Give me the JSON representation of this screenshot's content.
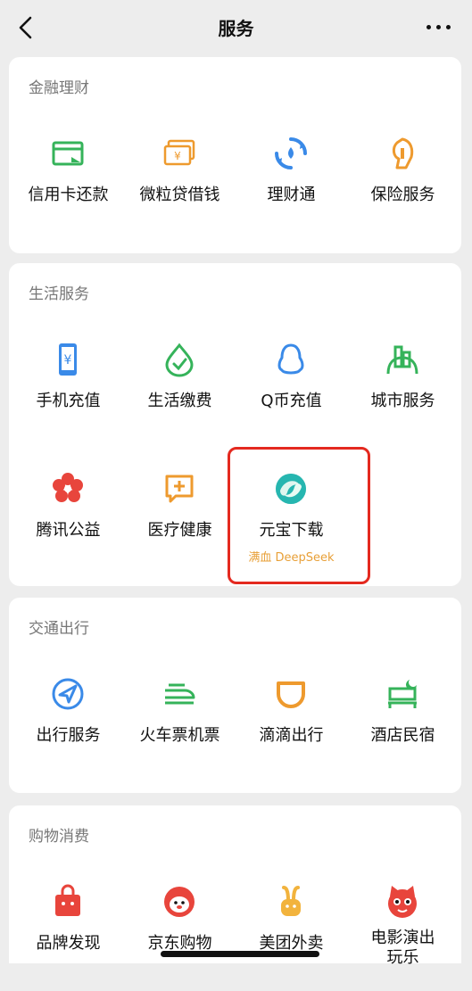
{
  "header": {
    "title": "服务"
  },
  "sections": [
    {
      "title": "金融理财",
      "items": [
        {
          "label": "信用卡还款",
          "icon": "card-icon"
        },
        {
          "label": "微粒贷借钱",
          "icon": "money-icon"
        },
        {
          "label": "理财通",
          "icon": "refresh-droplet-icon"
        },
        {
          "label": "保险服务",
          "icon": "umbrella-icon"
        }
      ]
    },
    {
      "title": "生活服务",
      "items": [
        {
          "label": "手机充值",
          "icon": "phone-yuan-icon"
        },
        {
          "label": "生活缴费",
          "icon": "droplet-check-icon"
        },
        {
          "label": "Q币充值",
          "icon": "penguin-icon"
        },
        {
          "label": "城市服务",
          "icon": "city-icon"
        },
        {
          "label": "腾讯公益",
          "icon": "flower-icon"
        },
        {
          "label": "医疗健康",
          "icon": "medical-chat-icon"
        },
        {
          "label": "元宝下载",
          "sub": "满血 DeepSeek",
          "icon": "yuanbao-icon"
        }
      ]
    },
    {
      "title": "交通出行",
      "items": [
        {
          "label": "出行服务",
          "icon": "navigation-icon"
        },
        {
          "label": "火车票机票",
          "icon": "train-icon"
        },
        {
          "label": "滴滴出行",
          "icon": "didi-icon"
        },
        {
          "label": "酒店民宿",
          "icon": "hotel-bed-icon"
        }
      ]
    },
    {
      "title": "购物消费",
      "items": [
        {
          "label": "品牌发现",
          "icon": "shopping-bag-icon"
        },
        {
          "label": "京东购物",
          "icon": "jd-dog-icon"
        },
        {
          "label": "美团外卖",
          "icon": "meituan-rabbit-icon"
        },
        {
          "label": "电影演出\n玩乐",
          "icon": "cat-icon"
        }
      ]
    }
  ],
  "colors": {
    "green": "#35b35a",
    "orange": "#ee9a2e",
    "blue": "#3a8ae8",
    "red": "#e8453c",
    "highlight_border": "#e4291f"
  }
}
